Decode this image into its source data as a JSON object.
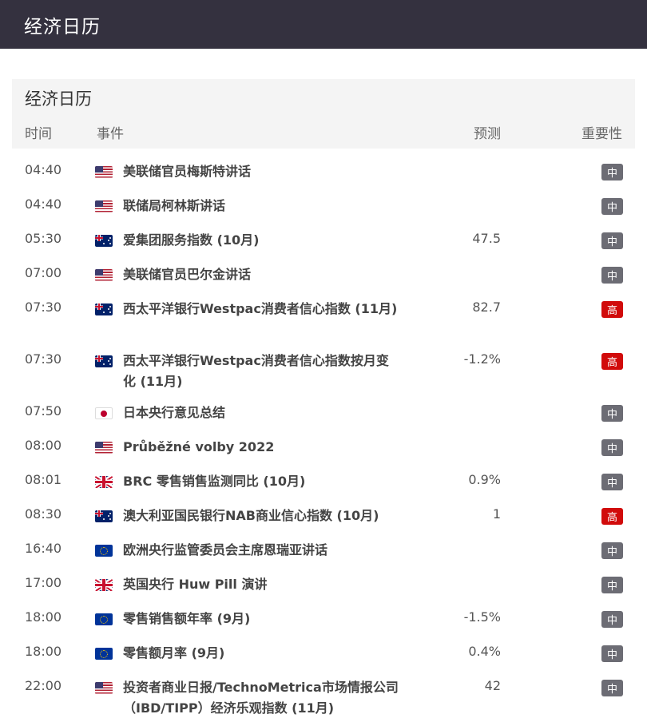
{
  "header": {
    "title": "经济日历"
  },
  "panel": {
    "title": "经济日历",
    "columns": {
      "time": "时间",
      "event": "事件",
      "forecast": "预测",
      "importance": "重要性"
    }
  },
  "rows": [
    {
      "time": "04:40",
      "flag": "us",
      "flag_icon": "us-flag-icon",
      "event": "美联储官员梅斯特讲话",
      "forecast": "",
      "importance": "中",
      "level": "mid",
      "tall": false
    },
    {
      "time": "04:40",
      "flag": "us",
      "flag_icon": "us-flag-icon",
      "event": "联储局柯林斯讲话",
      "forecast": "",
      "importance": "中",
      "level": "mid",
      "tall": false
    },
    {
      "time": "05:30",
      "flag": "au",
      "flag_icon": "au-flag-icon",
      "event": "爱集团服务指数 (10月)",
      "forecast": "47.5",
      "importance": "中",
      "level": "mid",
      "tall": false
    },
    {
      "time": "07:00",
      "flag": "us",
      "flag_icon": "us-flag-icon",
      "event": "美联储官员巴尔金讲话",
      "forecast": "",
      "importance": "中",
      "level": "mid",
      "tall": false
    },
    {
      "time": "07:30",
      "flag": "au",
      "flag_icon": "au-flag-icon",
      "event": "西太平洋银行Westpac消费者信心指数 (11月)",
      "forecast": "82.7",
      "importance": "高",
      "level": "high",
      "tall": true
    },
    {
      "time": "07:30",
      "flag": "au",
      "flag_icon": "au-flag-icon",
      "event": "西太平洋银行Westpac消费者信心指数按月变化 (11月)",
      "forecast": "-1.2%",
      "importance": "高",
      "level": "high",
      "tall": true
    },
    {
      "time": "07:50",
      "flag": "jp",
      "flag_icon": "jp-flag-icon",
      "event": "日本央行意见总结",
      "forecast": "",
      "importance": "中",
      "level": "mid",
      "tall": false
    },
    {
      "time": "08:00",
      "flag": "us",
      "flag_icon": "us-flag-icon",
      "event": "Průběžné volby 2022",
      "forecast": "",
      "importance": "中",
      "level": "mid",
      "tall": false
    },
    {
      "time": "08:01",
      "flag": "gb",
      "flag_icon": "gb-flag-icon",
      "event": "BRC 零售销售监测同比 (10月)",
      "forecast": "0.9%",
      "importance": "中",
      "level": "mid",
      "tall": false
    },
    {
      "time": "08:30",
      "flag": "au",
      "flag_icon": "au-flag-icon",
      "event": "澳大利亚国民银行NAB商业信心指数 (10月)",
      "forecast": "1",
      "importance": "高",
      "level": "high",
      "tall": false
    },
    {
      "time": "16:40",
      "flag": "eu",
      "flag_icon": "eu-flag-icon",
      "event": "欧洲央行监管委员会主席恩瑞亚讲话",
      "forecast": "",
      "importance": "中",
      "level": "mid",
      "tall": false
    },
    {
      "time": "17:00",
      "flag": "gb",
      "flag_icon": "gb-flag-icon",
      "event": "英国央行 Huw Pill 演讲",
      "forecast": "",
      "importance": "中",
      "level": "mid",
      "tall": false
    },
    {
      "time": "18:00",
      "flag": "eu",
      "flag_icon": "eu-flag-icon",
      "event": "零售销售额年率 (9月)",
      "forecast": "-1.5%",
      "importance": "中",
      "level": "mid",
      "tall": false
    },
    {
      "time": "18:00",
      "flag": "eu",
      "flag_icon": "eu-flag-icon",
      "event": "零售额月率 (9月)",
      "forecast": "0.4%",
      "importance": "中",
      "level": "mid",
      "tall": false
    },
    {
      "time": "22:00",
      "flag": "us",
      "flag_icon": "us-flag-icon",
      "event": "投资者商业日报/TechnoMetrica市场情报公司（IBD/TIPP）经济乐观指数 (11月)",
      "forecast": "42",
      "importance": "中",
      "level": "mid",
      "tall": true
    }
  ]
}
